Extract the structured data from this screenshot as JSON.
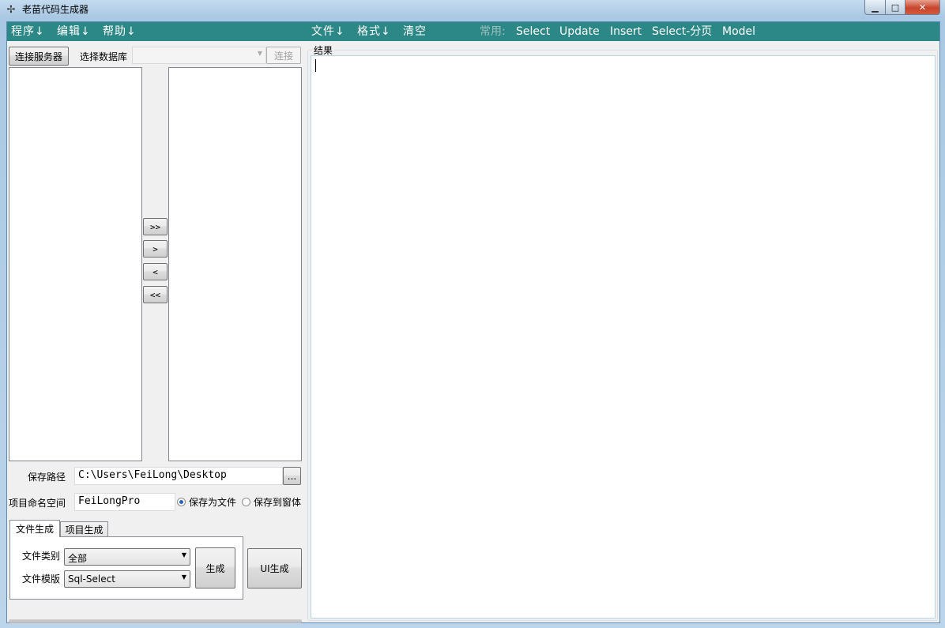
{
  "window": {
    "title": "老苗代码生成器",
    "app_icon": "bird-icon",
    "min_glyph": "▁",
    "max_glyph": "□",
    "close_glyph": "✕"
  },
  "menubar": {
    "program": "程序↓",
    "edit": "编辑↓",
    "help": "帮助↓",
    "file": "文件↓",
    "format": "格式↓",
    "clear": "清空",
    "common_label": "常用:",
    "select": "Select",
    "update": "Update",
    "insert": "Insert",
    "select_paged": "Select-分页",
    "model": "Model"
  },
  "connection": {
    "connect_server_button": "连接服务器",
    "select_db_label": "选择数据库",
    "db_value": "",
    "connect_button": "连接"
  },
  "transfer": {
    "move_all_right": ">>",
    "move_right": ">",
    "move_left": "<",
    "move_all_left": "<<"
  },
  "save": {
    "path_label": "保存路径",
    "path_value": "C:\\Users\\FeiLong\\Desktop",
    "browse_button": "...",
    "namespace_label": "项目命名空间",
    "namespace_value": "FeiLongPro",
    "save_to_file": "保存为文件",
    "save_to_window": "保存到窗体",
    "selected_option": "save_to_file"
  },
  "tabs": {
    "file_gen": "文件生成",
    "project_gen": "项目生成",
    "active": "file_gen"
  },
  "generator": {
    "file_type_label": "文件类别",
    "file_type_value": "全部",
    "template_label": "文件模版",
    "template_value": "Sql-Select",
    "generate_button": "生成",
    "ui_generate_button": "UI生成"
  },
  "result": {
    "label": "结果",
    "content": ""
  },
  "colors": {
    "menubar_bg": "#2c8886",
    "menubar_text": "#ffffff",
    "menubar_muted": "#9fbfbd"
  }
}
